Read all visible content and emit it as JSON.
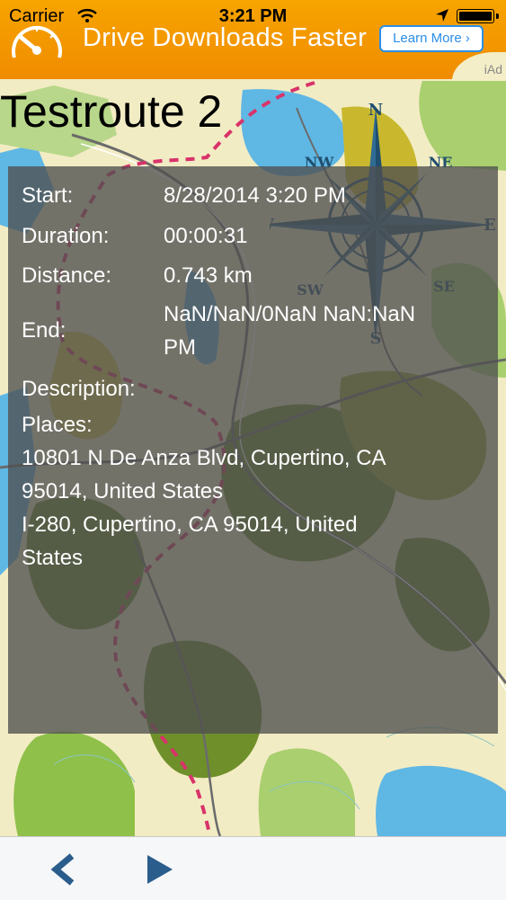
{
  "status_bar": {
    "carrier": "Carrier",
    "time": "3:21 PM"
  },
  "ad": {
    "title": "Drive Downloads Faster",
    "button_label": "Learn More ›",
    "badge": "iAd",
    "accent_color": "#f39a00"
  },
  "route": {
    "title": "Testroute 2"
  },
  "details": {
    "start_label": "Start:",
    "start_value": "8/28/2014 3:20 PM",
    "duration_label": "Duration:",
    "duration_value": "00:00:31",
    "distance_label": "Distance:",
    "distance_value": "0.743 km",
    "end_label": "End:",
    "end_value_line1": "NaN/NaN/0NaN NaN:NaN",
    "end_value_line2": "PM",
    "description_label": "Description:",
    "places_label": "Places:",
    "places": [
      "10801 N De Anza Blvd, Cupertino, CA",
      "95014, United States",
      "I-280, Cupertino, CA 95014, United",
      "States"
    ]
  },
  "compass": {
    "n": "N",
    "ne": "NE",
    "e": "E",
    "se": "SE",
    "s": "S",
    "sw": "SW",
    "w": "W",
    "nw": "NW"
  },
  "toolbar": {
    "back_icon": "chevron-left-icon",
    "play_icon": "play-icon"
  }
}
